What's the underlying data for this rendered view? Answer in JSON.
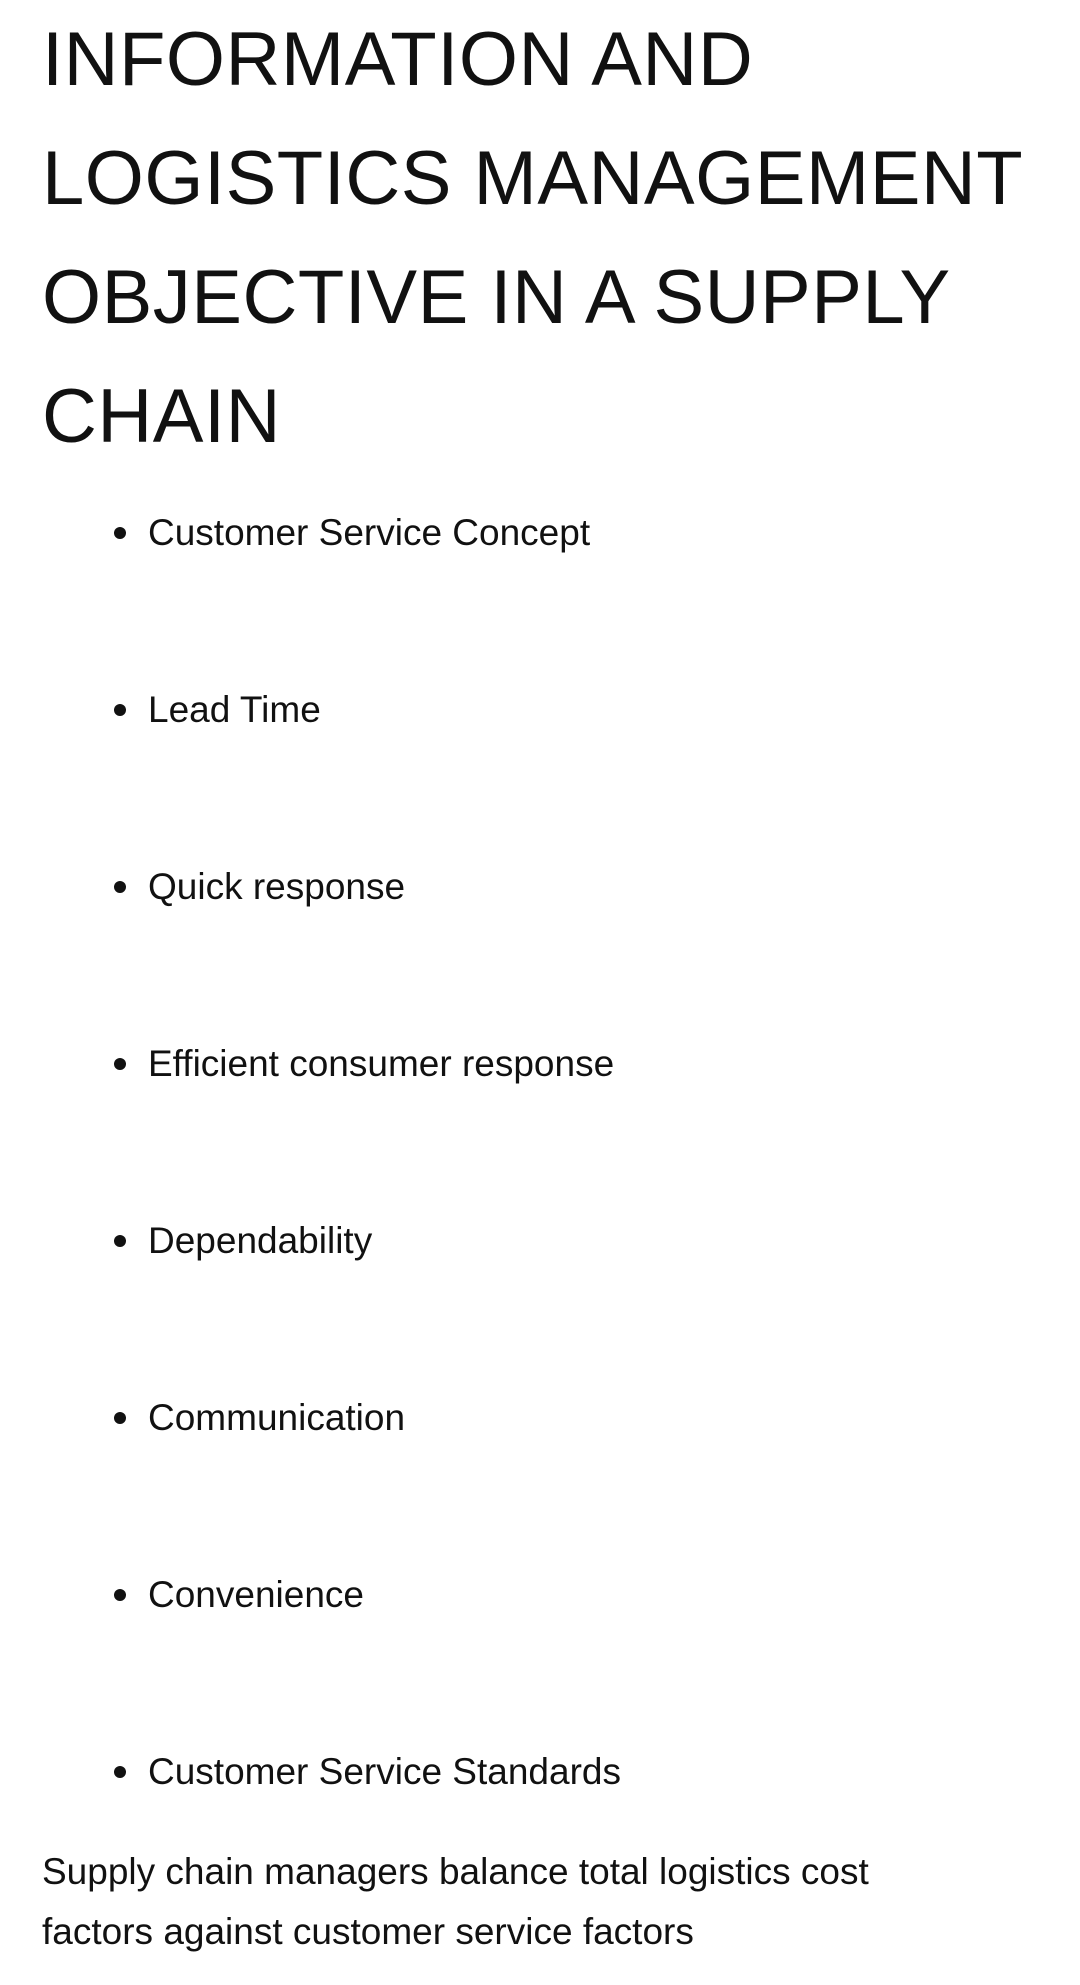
{
  "heading": {
    "lines": [
      "INFORMATION AND",
      "LOGISTICS MANAGEMENT",
      "OBJECTIVE IN A SUPPLY",
      "CHAIN"
    ]
  },
  "bullets": [
    "Customer Service Concept",
    "Lead Time",
    "Quick response",
    "Efficient consumer response",
    "Dependability",
    "Communication",
    "Convenience",
    "Customer Service Standards"
  ],
  "summary": {
    "lines": [
      "Supply chain managers balance total logistics cost",
      "factors against customer service factors"
    ]
  }
}
